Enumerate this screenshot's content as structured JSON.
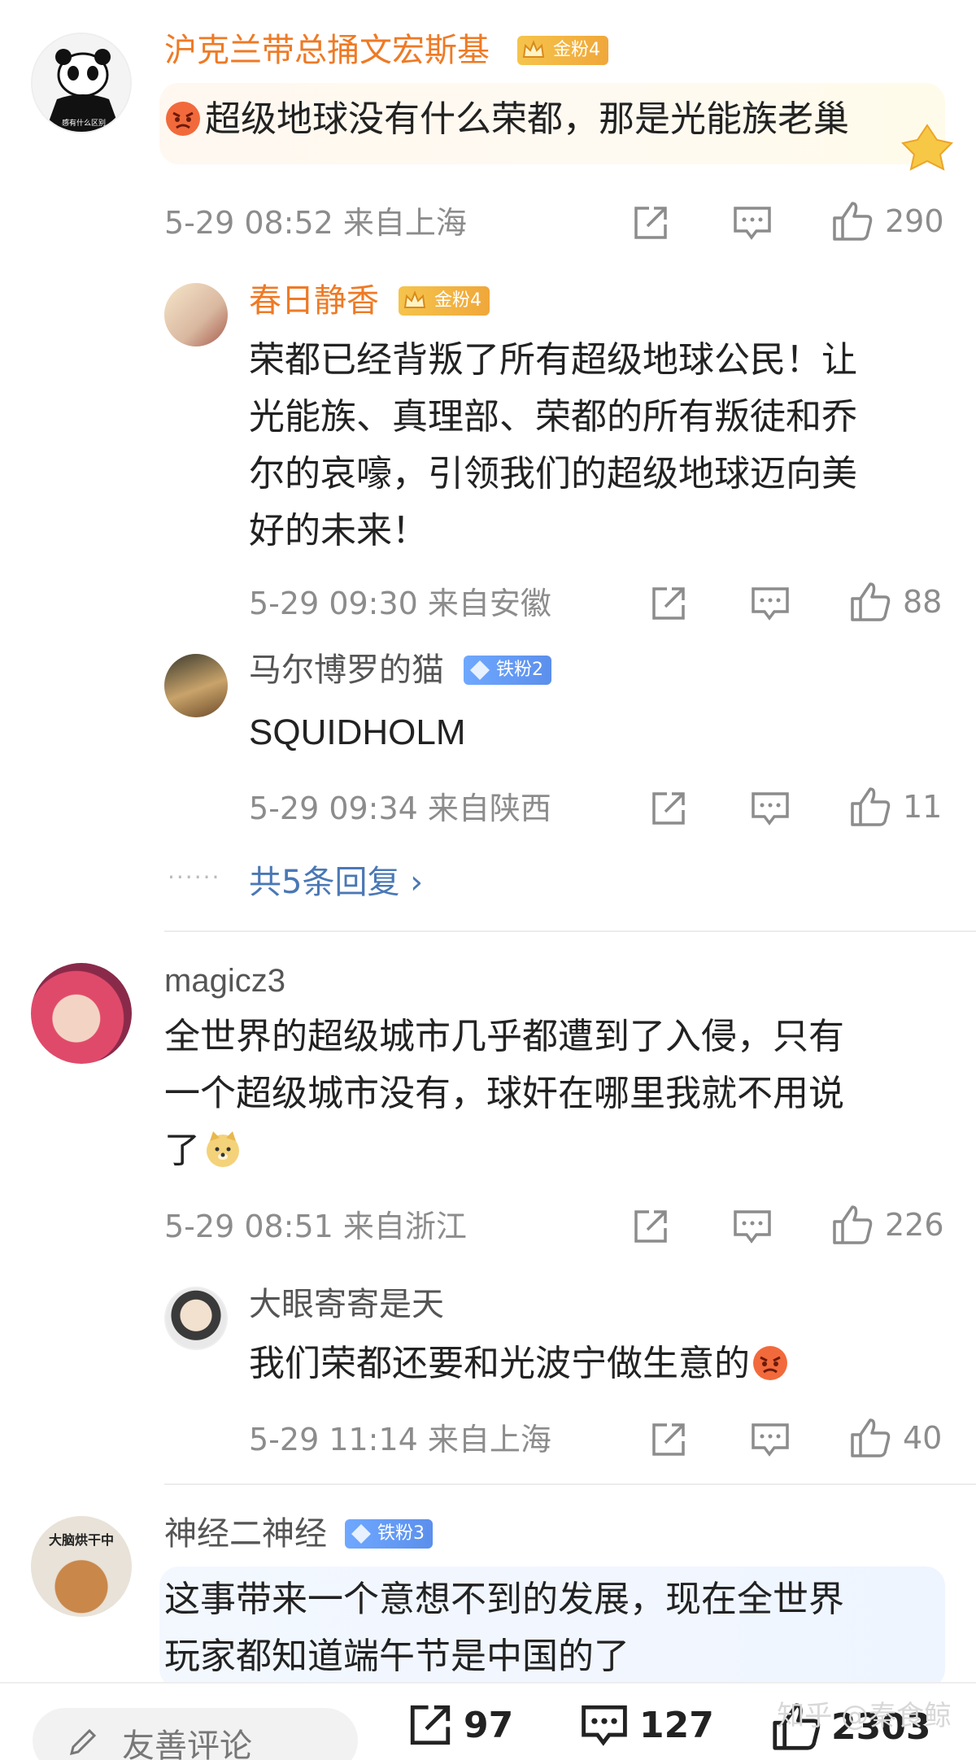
{
  "comments": [
    {
      "name": "沪克兰带总捅文宏斯基",
      "badge": "金粉4",
      "text": "超级地球没有什么荣都，那是光能族老巢",
      "meta": "5-29 08:52  来自上海",
      "likes": "290",
      "avatar_caption": "感有什么区别",
      "replies": [
        {
          "name": "春日静香",
          "badge": "金粉4",
          "lines": [
            "荣都已经背叛了所有超级地球公民！让",
            "光能族、真理部、荣都的所有叛徒和乔",
            "尔的哀嚎，引领我们的超级地球迈向美",
            "好的未来！"
          ],
          "meta": "5-29 09:30  来自安徽",
          "likes": "88"
        },
        {
          "name": "马尔博罗的猫",
          "badge": "铁粉2",
          "text": "SQUIDHOLM",
          "meta": "5-29 09:34  来自陕西",
          "likes": "11"
        }
      ],
      "more_replies": "共5条回复 ›"
    },
    {
      "name": "magicz3",
      "lines": [
        "全世界的超级城市几乎都遭到了入侵，只有",
        "一个超级城市没有，球奸在哪里我就不用说",
        "了"
      ],
      "meta": "5-29 08:51  来自浙江",
      "likes": "226",
      "replies": [
        {
          "name": "大眼寄寄是天",
          "text": "我们荣都还要和光波宁做生意的",
          "meta": "5-29 11:14  来自上海",
          "likes": "40"
        }
      ]
    },
    {
      "name": "神经二神经",
      "badge": "铁粉3",
      "avatar_caption": "大脑烘干中",
      "lines": [
        "这事带来一个意想不到的发展，现在全世界",
        "玩家都知道端午节是中国的了"
      ]
    }
  ],
  "bottom_bar": {
    "input_placeholder": "友善评论",
    "shares": "97",
    "comments": "127",
    "likes": "2303",
    "watermark": "知乎 @秦食鲸"
  },
  "colors": {
    "gold_name": "#ee7a25",
    "link": "#4a78b5",
    "meta": "#8c8c8c"
  }
}
